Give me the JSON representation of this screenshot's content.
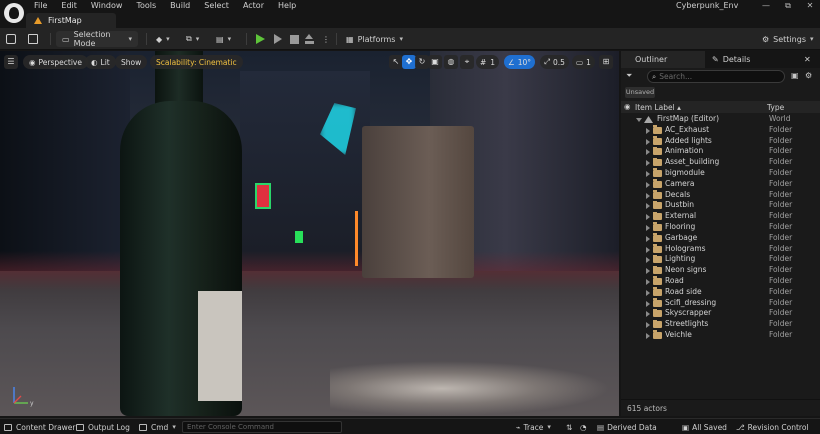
{
  "menu": [
    "File",
    "Edit",
    "Window",
    "Tools",
    "Build",
    "Select",
    "Actor",
    "Help"
  ],
  "document_tab": "FirstMap",
  "app_title": "Cyberpunk_Env",
  "window_controls": {
    "minimize": "—",
    "restore": "⧉",
    "close": "✕"
  },
  "toolbar": {
    "mode_label": "Selection Mode",
    "platforms_label": "Platforms",
    "settings_label": "Settings"
  },
  "viewport": {
    "hamburger": "☰",
    "perspective": "Perspective",
    "lit": "Lit",
    "show": "Show",
    "scalability": "Scalability: Cinematic",
    "grid_value": "1",
    "angle_value": "10°",
    "scale_value": "0.5",
    "camera_value": "1",
    "axis_label": "y"
  },
  "outliner": {
    "tab_outliner": "Outliner",
    "tab_details": "Details",
    "search_placeholder": "Search...",
    "unsaved": "Unsaved",
    "col_item_label": "Item Label ▴",
    "col_type": "Type",
    "world_row": {
      "name": "FirstMap (Editor)",
      "type": "World"
    },
    "folders": [
      {
        "name": "AC_Exhaust",
        "type": "Folder"
      },
      {
        "name": "Added lights",
        "type": "Folder"
      },
      {
        "name": "Animation",
        "type": "Folder"
      },
      {
        "name": "Asset_building",
        "type": "Folder"
      },
      {
        "name": "bigmodule",
        "type": "Folder"
      },
      {
        "name": "Camera",
        "type": "Folder"
      },
      {
        "name": "Decals",
        "type": "Folder"
      },
      {
        "name": "Dustbin",
        "type": "Folder"
      },
      {
        "name": "External",
        "type": "Folder"
      },
      {
        "name": "Flooring",
        "type": "Folder"
      },
      {
        "name": "Garbage",
        "type": "Folder"
      },
      {
        "name": "Holograms",
        "type": "Folder"
      },
      {
        "name": "Lighting",
        "type": "Folder"
      },
      {
        "name": "Neon signs",
        "type": "Folder"
      },
      {
        "name": "Road",
        "type": "Folder"
      },
      {
        "name": "Road side",
        "type": "Folder"
      },
      {
        "name": "Scifi_dressing",
        "type": "Folder"
      },
      {
        "name": "Skyscrapper",
        "type": "Folder"
      },
      {
        "name": "Streetlights",
        "type": "Folder"
      },
      {
        "name": "Veichle",
        "type": "Folder"
      }
    ],
    "footer": "615 actors"
  },
  "statusbar": {
    "content_drawer": "Content Drawer",
    "output_log": "Output Log",
    "cmd": "Cmd",
    "console_placeholder": "Enter Console Command",
    "trace": "Trace",
    "derived_data": "Derived Data",
    "all_saved": "All Saved",
    "revision_control": "Revision Control"
  }
}
